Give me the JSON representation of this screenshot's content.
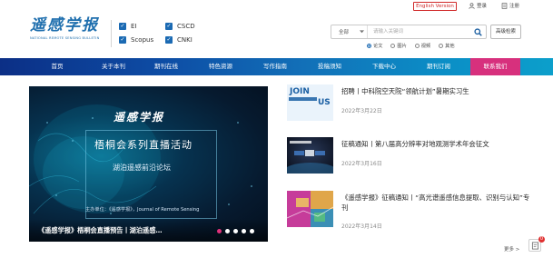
{
  "header": {
    "logo_title": "遥感学报",
    "logo_subtitle": "NATIONAL REMOTE SENSING BULLETIN",
    "indexes": [
      "EI",
      "CSCD",
      "Scopus",
      "CNKI"
    ],
    "lang_button": "English Version",
    "login": "登录",
    "register": "注册"
  },
  "search": {
    "scope": "全部",
    "placeholder": "请输入关键词",
    "advanced": "高级检索",
    "options": [
      "论文",
      "图片",
      "视频",
      "其他"
    ],
    "selected_option": "论文"
  },
  "nav": {
    "items": [
      "首页",
      "关于本刊",
      "期刊在线",
      "特色资源",
      "写作指南",
      "投稿须知",
      "下载中心",
      "期刊订阅",
      "联系我们"
    ],
    "active": "联系我们"
  },
  "banner": {
    "title": "遥感学报",
    "headline": "梧桐会系列直播活动",
    "forum": "湖泊遥感前沿论坛",
    "host": "主办单位：《遥感学报》，Journal of Remote Sensing",
    "caption": "《遥感学报》梧桐会直播预告丨湖泊遥感…",
    "slide_count": 5,
    "active_slide": 1
  },
  "news": [
    {
      "title": "招聘丨中科院空天院“领航计划”暑期实习生",
      "date": "2022年3月22日",
      "thumb_text": "JOIN",
      "thumb_text2": "US"
    },
    {
      "title": "征稿通知丨第八届高分辨率对地观测学术年会征文",
      "date": "2022年3月16日"
    },
    {
      "title": "《遥感学报》征稿通知丨“高光谱遥感信息提取、识别与认知”专刊",
      "date": "2022年3月14日"
    }
  ],
  "more": "更多 >",
  "float_badge": "0",
  "colors": {
    "brand_blue": "#1f6fae",
    "nav_active": "#d7307d",
    "lang_red": "#d02929"
  }
}
